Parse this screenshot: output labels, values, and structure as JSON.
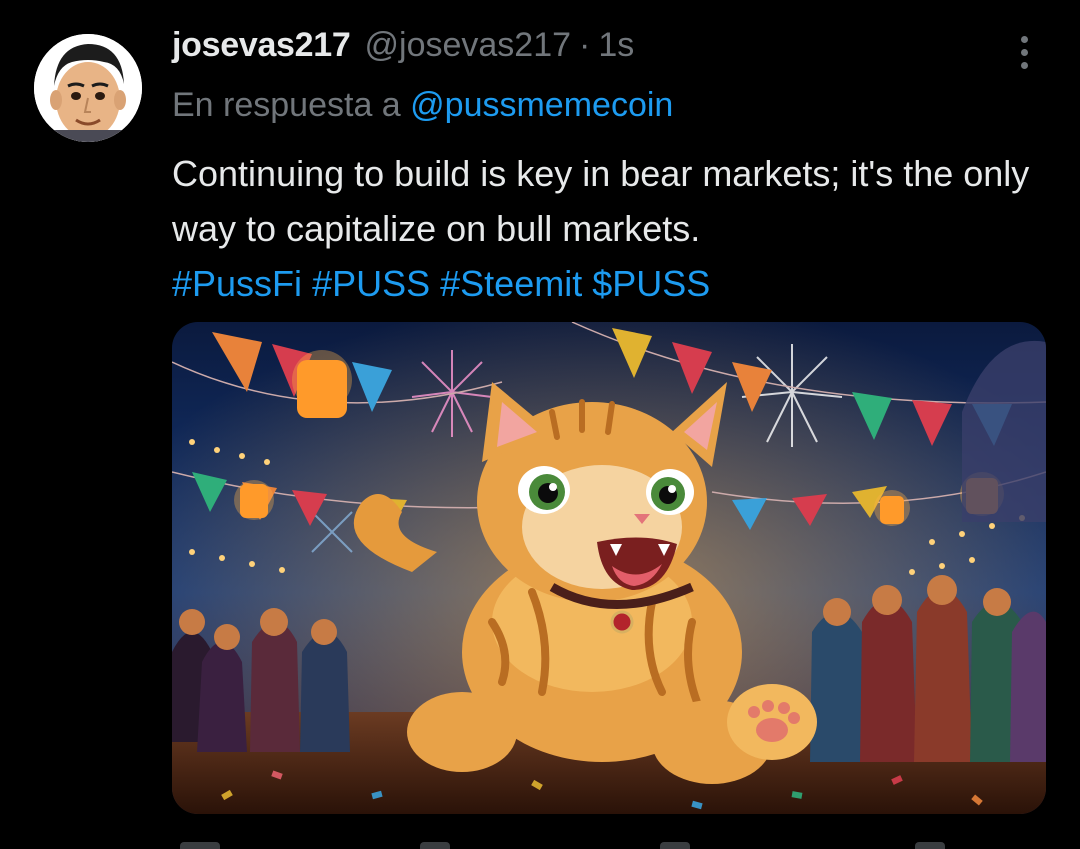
{
  "tweet": {
    "display_name": "josevas217",
    "handle": "@josevas217",
    "separator": "·",
    "time": "1s",
    "reply_prefix": "En respuesta a",
    "reply_mention": "@pussmemecoin",
    "text": "Continuing to build is key in bear markets; it's the only way to capitalize on bull markets.",
    "hashtags": [
      "#PussFi",
      "#PUSS",
      "#Steemit",
      "$PUSS"
    ]
  },
  "icons": {
    "avatar": "memoji-avatar",
    "more": "more-options-icon"
  },
  "colors": {
    "background": "#000000",
    "text": "#e7e9ea",
    "muted": "#71767b",
    "link": "#1d9bf0"
  }
}
